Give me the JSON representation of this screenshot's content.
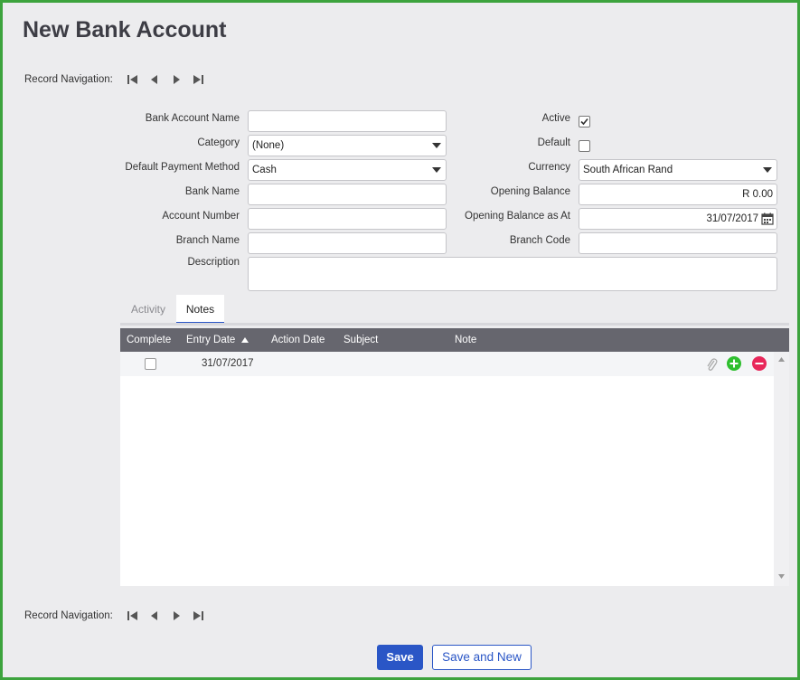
{
  "page": {
    "title": "New Bank Account"
  },
  "record_navigation": {
    "label": "Record Navigation:"
  },
  "form": {
    "bank_account_name": {
      "label": "Bank Account Name",
      "value": ""
    },
    "category": {
      "label": "Category",
      "value": "(None)"
    },
    "default_payment_method": {
      "label": "Default Payment Method",
      "value": "Cash"
    },
    "bank_name": {
      "label": "Bank Name",
      "value": ""
    },
    "account_number": {
      "label": "Account Number",
      "value": ""
    },
    "branch_name": {
      "label": "Branch Name",
      "value": ""
    },
    "description": {
      "label": "Description",
      "value": ""
    },
    "active": {
      "label": "Active",
      "checked": true
    },
    "default": {
      "label": "Default",
      "checked": false
    },
    "currency": {
      "label": "Currency",
      "value": "South African Rand"
    },
    "opening_balance": {
      "label": "Opening Balance",
      "value": "R 0.00"
    },
    "opening_balance_as_at": {
      "label": "Opening Balance as At",
      "value": "31/07/2017"
    },
    "branch_code": {
      "label": "Branch Code",
      "value": ""
    }
  },
  "tabs": [
    {
      "label": "Activity",
      "active": false
    },
    {
      "label": "Notes",
      "active": true
    }
  ],
  "notes_grid": {
    "columns": [
      "Complete",
      "Entry Date",
      "Action Date",
      "Subject",
      "Note"
    ],
    "sorted_column": "Entry Date",
    "rows": [
      {
        "complete": false,
        "entry_date": "31/07/2017",
        "action_date": "",
        "subject": "",
        "note": ""
      }
    ]
  },
  "buttons": {
    "save": "Save",
    "save_and_new": "Save and New"
  },
  "colors": {
    "accent": "#2a56c6",
    "frame_border": "#3da33d",
    "grid_header": "#66666e",
    "add": "#2fbf2f",
    "remove": "#e8275a"
  },
  "icons": [
    "first-record-icon",
    "previous-record-icon",
    "next-record-icon",
    "last-record-icon",
    "dropdown-arrow-icon",
    "calendar-icon",
    "checkmark-icon",
    "sort-ascending-icon",
    "paperclip-icon",
    "add-icon",
    "remove-icon",
    "scroll-up-icon",
    "scroll-down-icon"
  ]
}
